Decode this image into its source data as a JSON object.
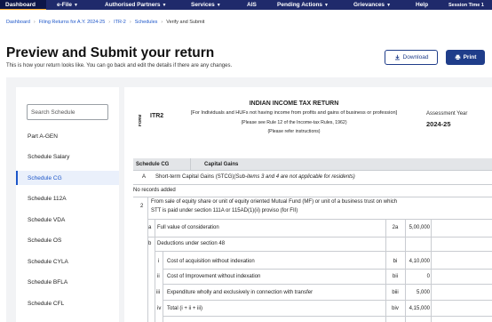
{
  "nav": {
    "items": [
      {
        "label": "Dashboard",
        "caret": false,
        "active": true
      },
      {
        "label": "e-File",
        "caret": true,
        "active": false
      },
      {
        "label": "Authorised Partners",
        "caret": true,
        "active": false
      },
      {
        "label": "Services",
        "caret": true,
        "active": false
      },
      {
        "label": "AIS",
        "caret": false,
        "active": false
      },
      {
        "label": "Pending Actions",
        "caret": true,
        "active": false
      },
      {
        "label": "Grievances",
        "caret": true,
        "active": false
      },
      {
        "label": "Help",
        "caret": false,
        "active": false
      },
      {
        "label": "Session Time 1",
        "caret": false,
        "active": false
      }
    ]
  },
  "breadcrumb": [
    "Dashboard",
    "Filing Returns for A.Y. 2024-25",
    "ITR-2",
    "Schedules",
    "Verify and Submit"
  ],
  "header": {
    "title": "Preview and Submit your return",
    "subtitle": "This is how your return looks like. You can go back and edit the details if there are any changes.",
    "download_label": "Download",
    "print_label": "Print"
  },
  "sidebar": {
    "search_placeholder": "Search Schedule",
    "items": [
      "Part A-GEN",
      "Schedule Salary",
      "Schedule CG",
      "Schedule 112A",
      "Schedule VDA",
      "Schedule OS",
      "Schedule CYLA",
      "Schedule BFLA",
      "Schedule CFL"
    ],
    "active_index": 2
  },
  "return": {
    "form_label": "FORM",
    "form_code": "ITR2",
    "title": "INDIAN INCOME TAX RETURN",
    "line1": "[For Individuals and HUFs not having income from profits and gains of business or profession]",
    "line2": "(Please see Rule 12 of the Income-tax Rules, 1962)",
    "line3": "(Please refer instructions)",
    "ay_label": "Assessment Year",
    "ay_value": "2024-25"
  },
  "schedule": {
    "code": "Schedule CG",
    "name": "Capital Gains",
    "sectionA_code": "A",
    "sectionA_text": "Short-term Capital Gains (STCG)",
    "sectionA_note": "(Sub-items 3 and 4 are not applicable for residents)",
    "no_records": "No records added",
    "item2_num": "2",
    "item2_line1": "From sale of equity share or unit of equity oriented Mutual Fund (MF) or unit of a business trust on which",
    "item2_line2": "STT is paid under section 111A or 115AD(1)(ii) proviso (for FII)",
    "rows": [
      {
        "key": "a",
        "label": "Full value of consideration",
        "code": "2a",
        "amount": "5,00,000"
      },
      {
        "key": "b",
        "label": "Deductions under section 48",
        "code": "",
        "amount": ""
      },
      {
        "key": "i",
        "label": "Cost of acquisition without indexation",
        "code": "bi",
        "amount": "4,10,000"
      },
      {
        "key": "ii",
        "label": "Cost of Improvement without indexation",
        "code": "bii",
        "amount": "0"
      },
      {
        "key": "iii",
        "label": "Expenditure wholly and exclusively in connection with transfer",
        "code": "biii",
        "amount": "5,000"
      },
      {
        "key": "iv",
        "label": "Total (i + ii + iii)",
        "code": "biv",
        "amount": "4,15,000"
      }
    ]
  },
  "colors": {
    "nav_bg": "#1f2a6b",
    "accent": "#1d56c9",
    "button_primary": "#1f3d8a"
  }
}
